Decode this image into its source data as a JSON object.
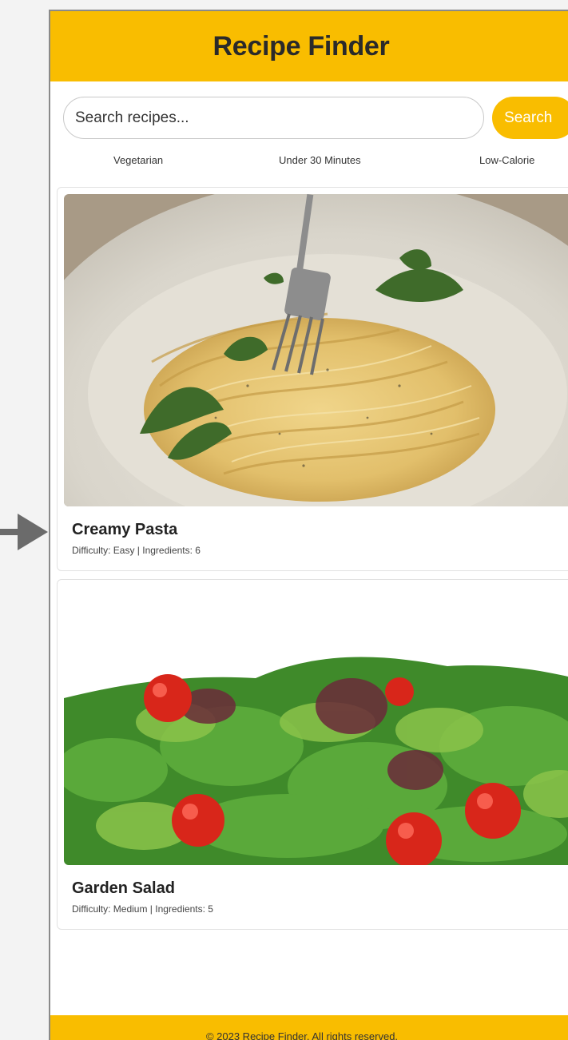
{
  "header": {
    "title": "Recipe Finder"
  },
  "search": {
    "placeholder": "Search recipes...",
    "button_label": "Search"
  },
  "filters": [
    "Vegetarian",
    "Under 30 Minutes",
    "Low-Calorie"
  ],
  "recipes": [
    {
      "title": "Creamy Pasta",
      "meta": "Difficulty: Easy | Ingredients: 6",
      "image": "creamy-pasta-photo"
    },
    {
      "title": "Garden Salad",
      "meta": "Difficulty: Medium | Ingredients: 5",
      "image": "garden-salad-photo"
    }
  ],
  "footer": {
    "text": "© 2023 Recipe Finder. All rights reserved."
  },
  "colors": {
    "accent": "#f9bd00",
    "text": "#222222",
    "border": "#e2e2e2"
  },
  "icons": {
    "pointer": "arrow-right-icon"
  }
}
